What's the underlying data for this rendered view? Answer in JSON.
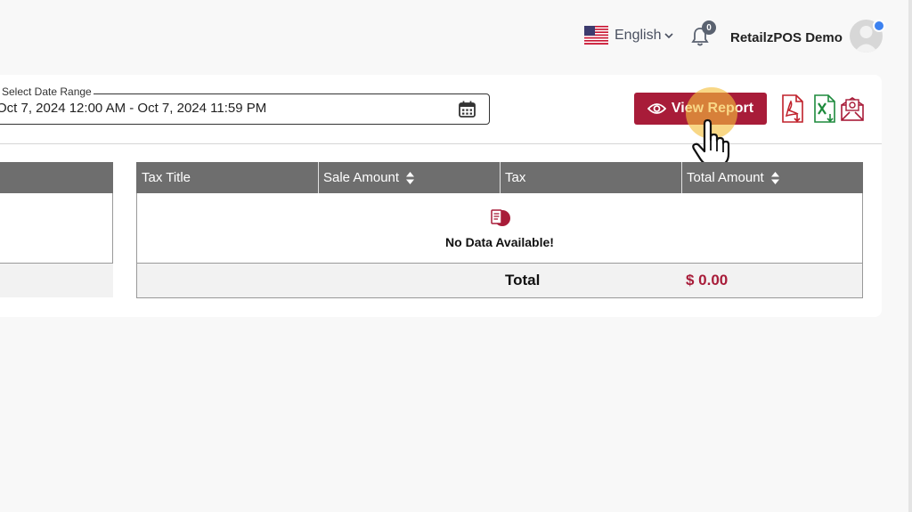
{
  "header": {
    "language": {
      "label": "English",
      "flag_icon": "us-flag-icon"
    },
    "notifications": {
      "icon": "bell-icon",
      "count": "0"
    },
    "user": {
      "name": "RetailzPOS Demo",
      "status_color": "#3d82f0"
    }
  },
  "filters": {
    "date_range": {
      "legend": "Select Date Range",
      "value": "Oct 7, 2024 12:00 AM - Oct 7, 2024 11:59 PM",
      "icon": "calendar-icon"
    }
  },
  "actions": {
    "view_report": {
      "label": "View Report",
      "icon": "eye-icon",
      "color": "#a81c39"
    },
    "exports": [
      {
        "name": "export-pdf-button",
        "icon": "pdf-icon",
        "color": "#c0202a"
      },
      {
        "name": "export-excel-button",
        "icon": "excel-icon",
        "color": "#1d8a3c"
      },
      {
        "name": "export-email-button",
        "icon": "email-icon",
        "color": "#a81c39"
      }
    ]
  },
  "table": {
    "columns": [
      {
        "label": "Tax Title",
        "sortable": false
      },
      {
        "label": "Sale Amount",
        "sortable": true
      },
      {
        "label": "Tax",
        "sortable": false
      },
      {
        "label": "Total Amount",
        "sortable": true
      }
    ],
    "empty_message": "No Data Available!",
    "total_label": "Total",
    "total_value": "$ 0.00"
  }
}
